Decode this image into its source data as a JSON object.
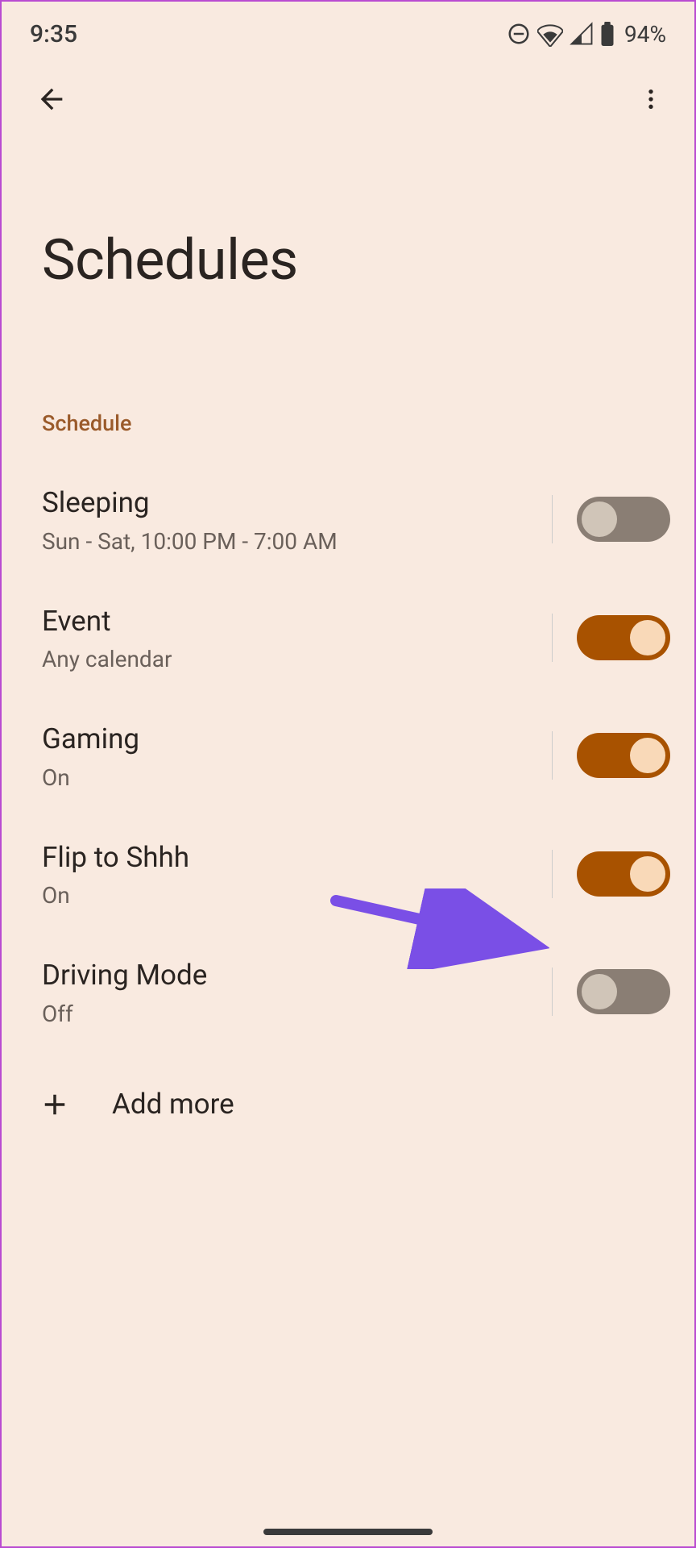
{
  "statusBar": {
    "time": "9:35",
    "battery": "94%"
  },
  "page": {
    "title": "Schedules",
    "sectionHeader": "Schedule"
  },
  "schedules": [
    {
      "title": "Sleeping",
      "subtitle": "Sun - Sat, 10:00 PM - 7:00 AM",
      "enabled": false
    },
    {
      "title": "Event",
      "subtitle": "Any calendar",
      "enabled": true
    },
    {
      "title": "Gaming",
      "subtitle": "On",
      "enabled": true
    },
    {
      "title": "Flip to Shhh",
      "subtitle": "On",
      "enabled": true
    },
    {
      "title": "Driving Mode",
      "subtitle": "Off",
      "enabled": false
    }
  ],
  "addMore": {
    "label": "Add more"
  }
}
